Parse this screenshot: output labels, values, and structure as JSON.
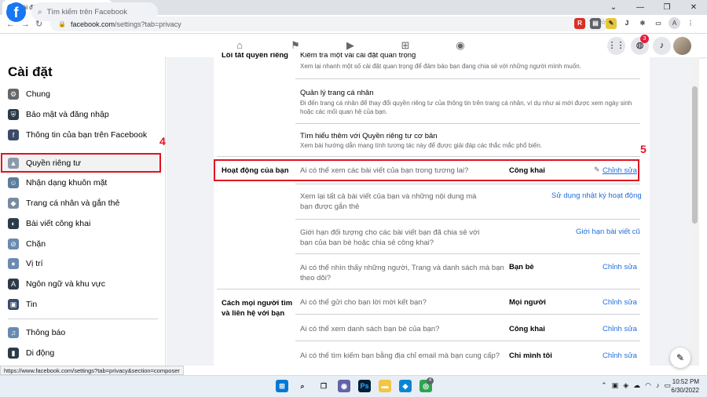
{
  "browser": {
    "tab_title": "Cài đặt & quyền riêng tư | Facebook",
    "tab_favicon": "f",
    "newtab": "+",
    "address_host": "facebook.com",
    "address_path": "/settings?tab=privacy",
    "profile_initial": "A",
    "status_url": "https://www.facebook.com/settings?tab=privacy&section=composer"
  },
  "fb": {
    "logo": "f",
    "search_placeholder": "Tìm kiếm trên Facebook",
    "notif_count": "3"
  },
  "sidebar": {
    "title": "Cài đặt",
    "items": [
      {
        "label": "Chung"
      },
      {
        "label": "Bảo mật và đăng nhập"
      },
      {
        "label": "Thông tin của bạn trên Facebook"
      },
      {
        "label": "Quyền riêng tư"
      },
      {
        "label": "Nhận dạng khuôn mặt"
      },
      {
        "label": "Trang cá nhân và gắn thẻ"
      },
      {
        "label": "Bài viết công khai"
      },
      {
        "label": "Chặn"
      },
      {
        "label": "Vị trí"
      },
      {
        "label": "Ngôn ngữ và khu vực"
      },
      {
        "label": "Tin"
      },
      {
        "label": "Thông báo"
      },
      {
        "label": "Di động"
      }
    ]
  },
  "annotations": {
    "n4": "4",
    "n5": "5"
  },
  "main": {
    "partial_heading": "Lối tắt quyền riêng tư",
    "shortcuts": [
      {
        "title": "Kiểm tra một vài cài đặt quan trọng",
        "desc": "Xem lại nhanh một số cài đặt quan trọng để đảm bảo bạn đang chia sẻ với những người mình muốn."
      },
      {
        "title": "Quản lý trang cá nhân",
        "desc": "Đi đến trang cá nhân để thay đổi quyền riêng tư của thông tin trên trang cá nhân, ví dụ như ai mới được xem ngày sinh hoặc các mối quan hệ của bạn."
      },
      {
        "title": "Tìm hiểu thêm với Quyền riêng tư cơ bản",
        "desc": "Xem bài hướng dẫn mang tính tương tác này để được giải đáp các thắc mắc phổ biến."
      }
    ],
    "activity_heading": "Hoạt động của bạn",
    "activity": [
      {
        "q": "Ai có thể xem các bài viết của bạn trong tương lai?",
        "v": "Công khai",
        "a": "Chỉnh sửa"
      },
      {
        "q": "Xem lại tất cả bài viết của bạn và những nội dung mà bạn được gắn thẻ",
        "v": "",
        "a": "Sử dụng nhật ký hoạt động"
      },
      {
        "q": "Giới hạn đối tượng cho các bài viết bạn đã chia sẻ với bạn của bạn bè hoặc chia sẻ công khai?",
        "v": "",
        "a": "Giới hạn bài viết cũ"
      },
      {
        "q": "Ai có thể nhìn thấy những người, Trang và danh sách mà bạn theo dõi?",
        "v": "Bạn bè",
        "a": "Chỉnh sửa"
      }
    ],
    "contact_heading": "Cách mọi người tìm và liên hệ với bạn",
    "contact": [
      {
        "q": "Ai có thể gửi cho bạn lời mời kết bạn?",
        "v": "Mọi người",
        "a": "Chỉnh sửa"
      },
      {
        "q": "Ai có thể xem danh sách bạn bè của bạn?",
        "v": "Công khai",
        "a": "Chỉnh sửa"
      },
      {
        "q": "Ai có thể tìm kiếm bạn bằng địa chỉ email mà bạn cung cấp?",
        "v": "Chỉ mình tôi",
        "a": "Chỉnh sửa"
      }
    ]
  },
  "taskbar": {
    "time": "10:52 PM",
    "date": "6/30/2022",
    "chrome_badge": "4"
  }
}
